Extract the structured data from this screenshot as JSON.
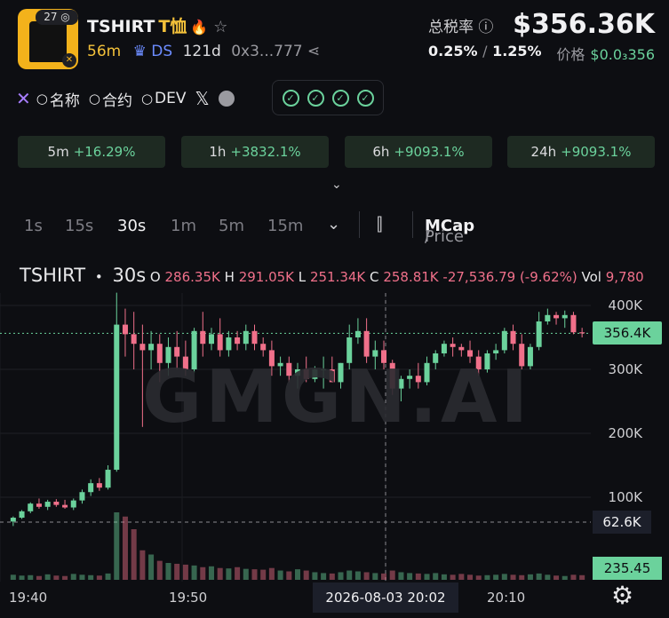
{
  "token": {
    "badge_count": "27",
    "name": "TSHIRT",
    "name_cn": "T恤",
    "age": "56m",
    "ds_label": "DS",
    "days": "121d",
    "address": "0x3...777"
  },
  "tax": {
    "label": "总税率",
    "buy": "0.25%",
    "sell": "1.25%",
    "sep": "/"
  },
  "market": {
    "mcap": "$356.36K",
    "price_label": "价格",
    "price_value": "$0.0₃356"
  },
  "links": [
    "名称",
    "合约",
    "DEV"
  ],
  "changes": [
    {
      "period": "5m",
      "value": "+16.29%"
    },
    {
      "period": "1h",
      "value": "+3832.1%"
    },
    {
      "period": "6h",
      "value": "+9093.1%"
    },
    {
      "period": "24h",
      "value": "+9093.1%"
    }
  ],
  "timeframes": [
    "1s",
    "15s",
    "30s",
    "1m",
    "5m",
    "15m"
  ],
  "active_timeframe": "30s",
  "price_toggle": {
    "price": "Price",
    "sep": "/",
    "mcap": "MCap"
  },
  "ohlc": {
    "symbol": "TSHIRT",
    "dot": "•",
    "interval": "30s",
    "o_label": "O",
    "o": "286.35K",
    "h_label": "H",
    "h": "291.05K",
    "l_label": "L",
    "l": "251.34K",
    "c_label": "C",
    "c": "258.81K",
    "change": "-27,536.79 (-9.62%)",
    "vol_label": "Vol",
    "vol": "9,780"
  },
  "watermark": "GMGN.AI",
  "y_ticks": [
    "400K",
    "300K",
    "200K",
    "100K"
  ],
  "last_price_tag": "356.4K",
  "low_tag": "62.6K",
  "volume_tag": "235.45",
  "x_ticks": [
    "19:40",
    "19:50",
    "20:10"
  ],
  "x_selected": "2026-08-03 20:02",
  "colors": {
    "up": "#6bd29c",
    "down": "#f0708a",
    "accent": "#f3c13a",
    "bg": "#0d0e12"
  },
  "chart_data": {
    "type": "candlestick",
    "ylabel": "MCap",
    "ylim": [
      0,
      430000
    ],
    "candles": [
      [
        62000,
        70000,
        55000,
        68000
      ],
      [
        68000,
        80000,
        66000,
        78000
      ],
      [
        78000,
        92000,
        75000,
        90000
      ],
      [
        90000,
        98000,
        82000,
        85000
      ],
      [
        85000,
        96000,
        80000,
        93000
      ],
      [
        93000,
        97000,
        85000,
        88000
      ],
      [
        88000,
        96000,
        82000,
        84000
      ],
      [
        84000,
        98000,
        80000,
        95000
      ],
      [
        95000,
        112000,
        90000,
        108000
      ],
      [
        108000,
        128000,
        102000,
        122000
      ],
      [
        122000,
        130000,
        110000,
        115000
      ],
      [
        115000,
        150000,
        112000,
        143000
      ],
      [
        143000,
        420000,
        140000,
        370000
      ],
      [
        370000,
        395000,
        320000,
        355000
      ],
      [
        355000,
        390000,
        300000,
        340000
      ],
      [
        340000,
        370000,
        210000,
        330000
      ],
      [
        330000,
        360000,
        300000,
        340000
      ],
      [
        340000,
        355000,
        280000,
        310000
      ],
      [
        310000,
        350000,
        290000,
        335000
      ],
      [
        335000,
        360000,
        300000,
        320000
      ],
      [
        320000,
        345000,
        290000,
        300000
      ],
      [
        300000,
        365000,
        295000,
        360000
      ],
      [
        360000,
        390000,
        320000,
        340000
      ],
      [
        340000,
        365000,
        330000,
        355000
      ],
      [
        355000,
        380000,
        320000,
        330000
      ],
      [
        330000,
        360000,
        320000,
        350000
      ],
      [
        350000,
        360000,
        330000,
        340000
      ],
      [
        340000,
        370000,
        330000,
        360000
      ],
      [
        360000,
        370000,
        330000,
        340000
      ],
      [
        340000,
        350000,
        320000,
        330000
      ],
      [
        330000,
        345000,
        290000,
        305000
      ],
      [
        305000,
        320000,
        290000,
        310000
      ],
      [
        310000,
        320000,
        280000,
        290000
      ],
      [
        290000,
        310000,
        270000,
        300000
      ],
      [
        300000,
        320000,
        280000,
        285000
      ],
      [
        285000,
        305000,
        280000,
        300000
      ],
      [
        300000,
        320000,
        270000,
        300000
      ],
      [
        300000,
        320000,
        280000,
        280000
      ],
      [
        280000,
        310000,
        270000,
        310000
      ],
      [
        310000,
        370000,
        300000,
        350000
      ],
      [
        350000,
        380000,
        340000,
        360000
      ],
      [
        360000,
        380000,
        310000,
        320000
      ],
      [
        320000,
        345000,
        300000,
        330000
      ],
      [
        330000,
        345000,
        300000,
        310000
      ],
      [
        310000,
        315000,
        260000,
        270000
      ],
      [
        270000,
        290000,
        250000,
        285000
      ],
      [
        285000,
        300000,
        270000,
        290000
      ],
      [
        290000,
        310000,
        270000,
        280000
      ],
      [
        280000,
        320000,
        275000,
        310000
      ],
      [
        310000,
        330000,
        300000,
        325000
      ],
      [
        325000,
        345000,
        320000,
        340000
      ],
      [
        340000,
        350000,
        320000,
        335000
      ],
      [
        335000,
        340000,
        320000,
        330000
      ],
      [
        330000,
        345000,
        310000,
        320000
      ],
      [
        320000,
        330000,
        290000,
        300000
      ],
      [
        300000,
        330000,
        295000,
        325000
      ],
      [
        325000,
        340000,
        315000,
        330000
      ],
      [
        330000,
        365000,
        325000,
        360000
      ],
      [
        360000,
        370000,
        330000,
        340000
      ],
      [
        340000,
        355000,
        300000,
        305000
      ],
      [
        305000,
        340000,
        300000,
        335000
      ],
      [
        335000,
        390000,
        330000,
        375000
      ],
      [
        375000,
        395000,
        370000,
        385000
      ],
      [
        385000,
        390000,
        370000,
        380000
      ],
      [
        380000,
        392000,
        365000,
        385000
      ],
      [
        385000,
        390000,
        355000,
        358000
      ],
      [
        358000,
        365000,
        350000,
        356360
      ]
    ],
    "volume": [
      12,
      10,
      11,
      9,
      13,
      10,
      9,
      14,
      12,
      11,
      10,
      15,
      160,
      150,
      120,
      70,
      60,
      45,
      40,
      38,
      36,
      34,
      30,
      32,
      28,
      27,
      30,
      26,
      25,
      24,
      28,
      22,
      20,
      25,
      22,
      18,
      16,
      15,
      18,
      22,
      20,
      18,
      16,
      15,
      22,
      18,
      16,
      15,
      14,
      16,
      13,
      12,
      14,
      12,
      10,
      11,
      12,
      14,
      12,
      11,
      13,
      15,
      12,
      10,
      9,
      12,
      11
    ]
  }
}
